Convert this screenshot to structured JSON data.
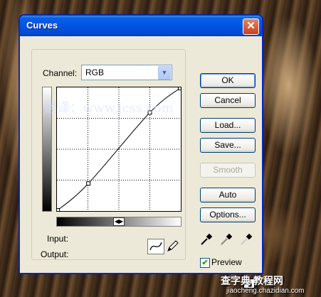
{
  "window": {
    "title": "Curves",
    "close_glyph": "✕"
  },
  "channel": {
    "label": "Channel:",
    "value": "RGB"
  },
  "labels": {
    "input": "Input:",
    "output": "Output:"
  },
  "buttons": {
    "ok": "OK",
    "cancel": "Cancel",
    "load": "Load...",
    "save": "Save...",
    "smooth": "Smooth",
    "auto": "Auto",
    "options": "Options..."
  },
  "preview": {
    "label": "Preview",
    "checked": true
  },
  "curve": {
    "points": [
      [
        0,
        0
      ],
      [
        64,
        56
      ],
      [
        192,
        204
      ],
      [
        255,
        255
      ]
    ]
  },
  "icons": [
    "curve-tool-icon",
    "pencil-tool-icon",
    "black-eyedropper-icon",
    "gray-eyedropper-icon",
    "white-eyedropper-icon",
    "expand-icon"
  ],
  "watermark": {
    "text": "翻译：www.jcss.com"
  },
  "site": {
    "name": "查字典 教程网",
    "url": "jiaocheng.chazidian.com"
  },
  "colors": {
    "title_blue": "#0054e3",
    "dialog_bg": "#ece9d8",
    "close_red": "#c9411e"
  }
}
